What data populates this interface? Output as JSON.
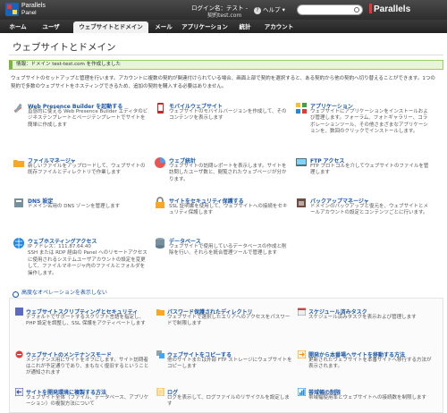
{
  "header": {
    "brand_line1": "Parallels",
    "brand_line2": "Panel",
    "login_label": "ログイン名：テスト -",
    "login_domain": "契約test.com",
    "help_label": "ヘルプ",
    "search_placeholder": "",
    "vendor": "Parallels"
  },
  "tabs": [
    {
      "label": "ホーム"
    },
    {
      "label": "ユーザ"
    },
    {
      "label": "ウェブサイトとドメイン",
      "active": true
    },
    {
      "label": "メール"
    },
    {
      "label": "アプリケーション"
    },
    {
      "label": "統計"
    },
    {
      "label": "アカウント"
    }
  ],
  "page": {
    "title": "ウェブサイトとドメイン",
    "message": "情報：ドメイン test-test.com を作成しました",
    "intro": "ウェブサイトのセットアップと管理を行います。アカウントに複数の契約が関連付けられている場合、画面上部で契約を選択すると、ある契約から他の契約へ切り替えることができます。1つの契約で多数のウェブサイトをホスティングできるため、追加の契約を購入する必要はありません。"
  },
  "features": [
    {
      "title": "Web Presence Builder を起動する",
      "desc": "直感的に使える Web Presence Builder エディタのビジネステンプレートとページテンプレートでサイトを簡単に作成します",
      "icon": "builder-icon"
    },
    {
      "title": "モバイルウェブサイト",
      "desc": "ウェブサイトのモバイルバージョンを作成して、そのコンテンツを表示します",
      "icon": "mobile-icon"
    },
    {
      "title": "アプリケーション",
      "desc": "ウェブサイトにアプリケーションをインストールおよび管理します。フォーラム、フォトギャラリー、コラボレーションツール、その他さまざまなアプリケーションを、数回のクリックでインストールします。",
      "icon": "applications-icon"
    },
    {
      "title": "ファイルマネージャ",
      "desc": "新しいファイルをアップロードして、ウェブサイトの既存ファイルとディレクトリで作業します",
      "icon": "file-manager-icon"
    },
    {
      "title": "ウェブ統計",
      "desc": "ウェブサイトの訪問レポートを表示します。サイトを訪問したユーザ数と、閲覧されたウェブページが分かります。",
      "icon": "web-stats-icon"
    },
    {
      "title": "FTP アクセス",
      "desc": "FTP プロトコルを介してウェブサイトのファイルを管理します",
      "icon": "ftp-icon"
    },
    {
      "title": "DNS 設定",
      "desc": "ドメイン名用の DNS ゾーンを管理します",
      "icon": "dns-icon"
    },
    {
      "title": "サイトをセキュリティ保護する",
      "desc": "SSL 証明書を使用して、ウェブサイトへの接続をセキュリティ保護します",
      "icon": "lock-icon"
    },
    {
      "title": "バックアップマネージャ",
      "desc": "ドメインのバックアップと復元を、ウェブサイトとメールアカウントの設定とコンテンツごとに行います。",
      "icon": "backup-icon"
    },
    {
      "title": "ウェブホスティングアクセス",
      "desc": "IP アドレス：111.87.64.40\nSSH または RDP 経由の Panel へのリモートアクセスに使用されるシステムユーザアカウントの設定を変更して、ファイルマネージャ内のファイルとフォルダを操作します。",
      "icon": "hosting-icon"
    },
    {
      "title": "データベース",
      "desc": "ウェブサイトで使用しているデータベースの作成と削除を行い、それらを統合管理ツールで管理します",
      "icon": "database-icon"
    }
  ],
  "advanced_toggle": "高度なオペレーションを表示しない",
  "advanced": [
    {
      "title": "ウェブサイトスクリプティングとセキュリティ",
      "desc": "デフォルトでサポートするスクリプト言語を指定し、PHP 設定を調整し、SSL 保護をアクティベートします",
      "icon": "scripting-icon"
    },
    {
      "title": "パスワード保護されたディレクトリ",
      "desc": "ウェブサイトで選択したエリアへのアクセスをパスワードで制限します",
      "icon": "folder-lock-icon"
    },
    {
      "title": "スケジュール済みタスク",
      "desc": "スケジュール済みタスクを表示および管理します",
      "icon": "calendar-icon"
    },
    {
      "title": "ウェブサイトのメンテナンスモード",
      "desc": "メンテナンス用にサイトをオフにします。サイト訪問者はこれが予定通りであり、まもなく復旧するということが通知されます",
      "icon": "maintenance-icon"
    },
    {
      "title": "ウェブサイトをコピーする",
      "desc": "他のサイトまたは外部 FTP ストレージにウェブサイトをコピーします",
      "icon": "copy-icon"
    },
    {
      "title": "開発から本番場へサイトを移動する方法",
      "desc": "更新されたウェブサイトを本番サイトへ移行する方法が表示されます。",
      "icon": "migrate-icon"
    },
    {
      "title": "サイトを開発環境に複製する方法",
      "desc": "ウェブサイト全体（ファイル、データベース、アプリケーション）の複製方法について",
      "icon": "clone-icon"
    },
    {
      "title": "ログ",
      "desc": "ログを表示して、ログファイルのリサイクルを設定します",
      "icon": "logs-icon"
    },
    {
      "title": "帯域幅の制限",
      "desc": "帯域幅使用率とウェブサイトへの接続数を制限します",
      "icon": "bandwidth-icon"
    }
  ]
}
